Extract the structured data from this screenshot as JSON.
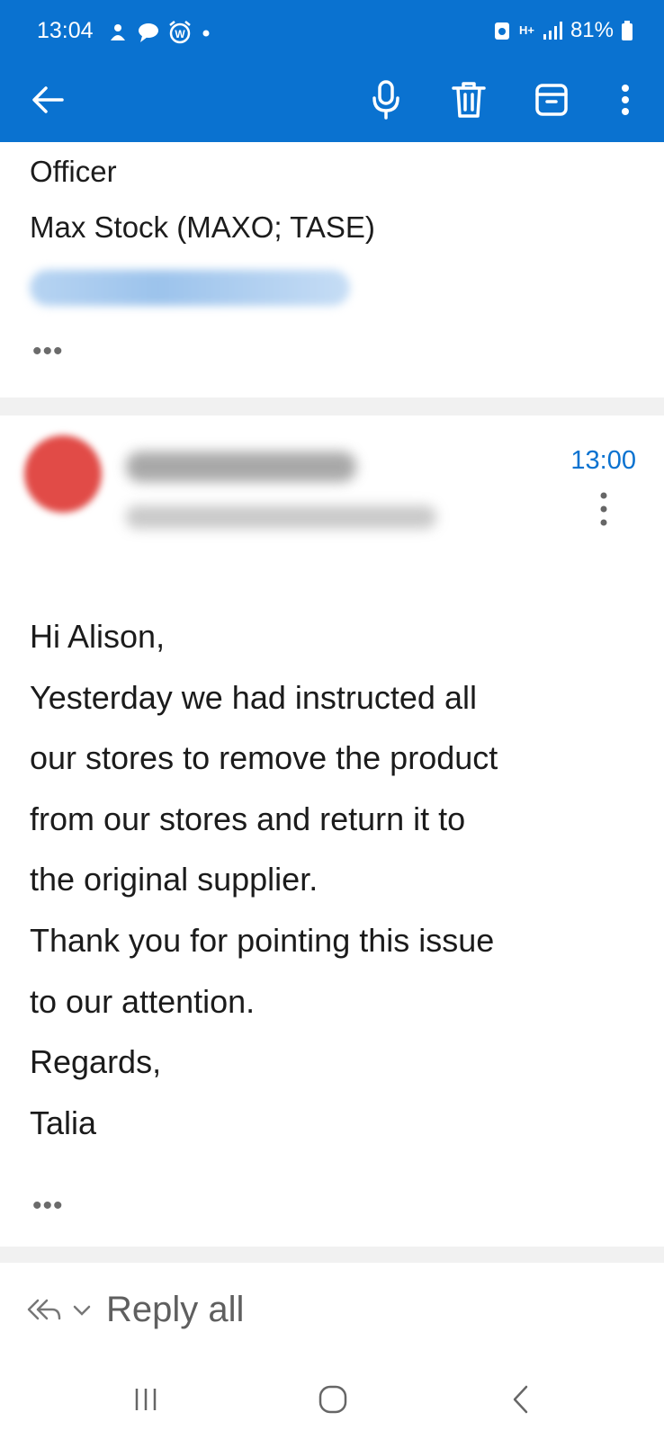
{
  "status_bar": {
    "time": "13:04",
    "battery": "81%",
    "network": "H+",
    "notification_icons": [
      "drone-icon",
      "chat-bubble-icon",
      "alarm-w-icon",
      "dot-icon"
    ]
  },
  "toolbar": {
    "icons": [
      "back-arrow-icon",
      "microphone-icon",
      "trash-icon",
      "archive-icon",
      "more-vertical-icon"
    ]
  },
  "previous_message": {
    "signature_lines": [
      "Officer",
      "Max Stock (MAXO; TASE)"
    ],
    "more": "•••"
  },
  "message": {
    "time": "13:00",
    "body_lines": [
      "Hi Alison,",
      "Yesterday we had instructed all",
      "our stores to remove the product",
      "from our stores and return it to",
      "the original supplier.",
      "Thank you for pointing this issue",
      "to our attention.",
      "Regards,",
      "Talia"
    ],
    "more": "•••"
  },
  "footer": {
    "reply_label": "Reply all"
  },
  "colors": {
    "accent": "#0a72d0",
    "avatar": "#e14b47"
  }
}
